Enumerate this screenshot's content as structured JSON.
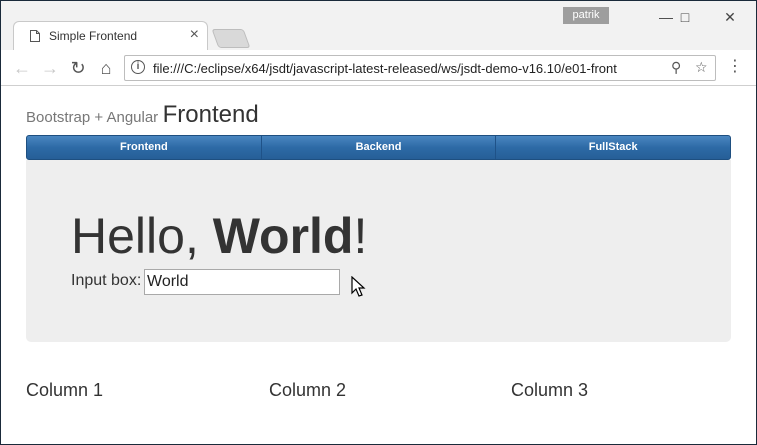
{
  "browser": {
    "user": "patrik",
    "tab_title": "Simple Frontend",
    "url": "file:///C:/eclipse/x64/jsdt/javascript-latest-released/ws/jsdt-demo-v16.10/e01-front"
  },
  "page": {
    "brand_sub": "Bootstrap + Angular",
    "brand_main": "Frontend",
    "nav": [
      "Frontend",
      "Backend",
      "FullStack"
    ],
    "hello_prefix": "Hello,",
    "hello_name": "World",
    "hello_suffix": "!",
    "input_label": "Input box:",
    "input_value": "World",
    "columns": [
      "Column 1",
      "Column 2",
      "Column 3"
    ]
  }
}
